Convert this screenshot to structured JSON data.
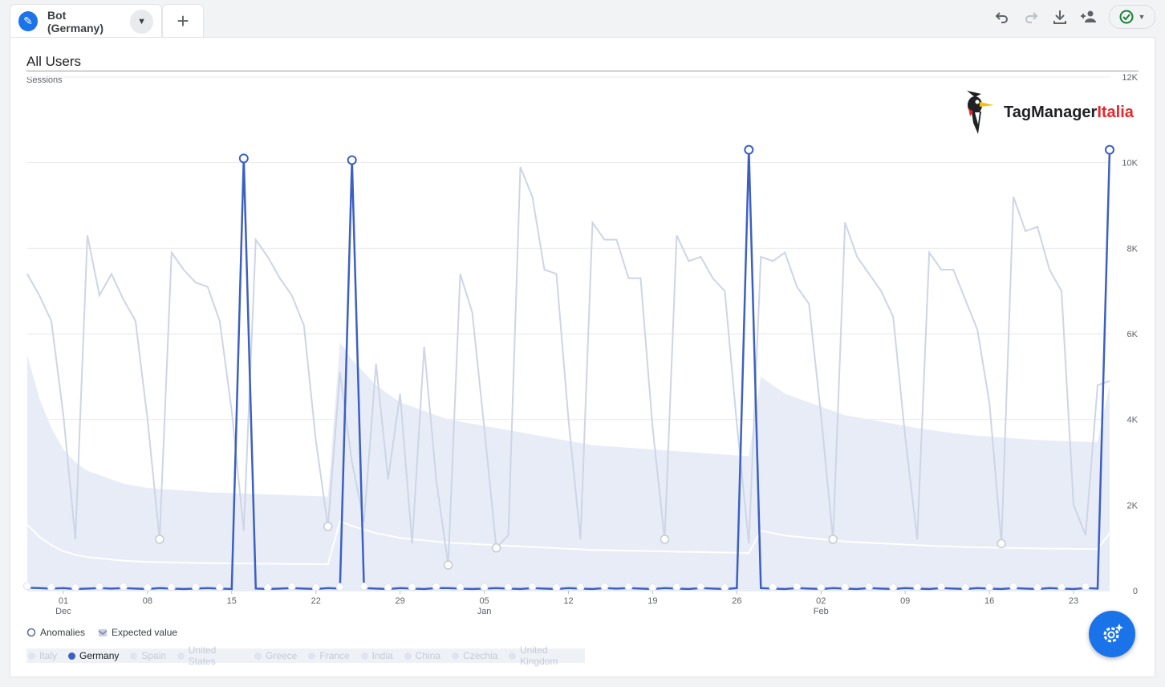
{
  "tab": {
    "segment_label": "Bot (Germany)",
    "add_label": "+"
  },
  "chart": {
    "title": "All Users",
    "metric": "Sessions"
  },
  "logo": {
    "part1": "TagManager",
    "part2": "Italia"
  },
  "legend_top": {
    "anomalies": "Anomalies",
    "expected": "Expected value"
  },
  "legend_countries": [
    "Italy",
    "Germany",
    "Spain",
    "United States",
    "Greece",
    "France",
    "India",
    "China",
    "Czechia",
    "United Kingdom"
  ],
  "active_country": "Germany",
  "colors": {
    "accent": "#1a73e8",
    "germany": "#3c5fc4",
    "faded": "#cdd5e6",
    "band": "#e8ecf7"
  },
  "chart_data": {
    "type": "line",
    "y_ticks": [
      "0",
      "2K",
      "4K",
      "6K",
      "8K",
      "10K",
      "12K"
    ],
    "ylim": [
      0,
      12000
    ],
    "x_ticks": [
      {
        "i": 3,
        "day": "01",
        "month": "Dec"
      },
      {
        "i": 10,
        "day": "08",
        "month": ""
      },
      {
        "i": 17,
        "day": "15",
        "month": ""
      },
      {
        "i": 24,
        "day": "22",
        "month": ""
      },
      {
        "i": 31,
        "day": "29",
        "month": ""
      },
      {
        "i": 38,
        "day": "05",
        "month": "Jan"
      },
      {
        "i": 45,
        "day": "12",
        "month": ""
      },
      {
        "i": 52,
        "day": "19",
        "month": ""
      },
      {
        "i": 59,
        "day": "26",
        "month": ""
      },
      {
        "i": 66,
        "day": "02",
        "month": "Feb"
      },
      {
        "i": 73,
        "day": "09",
        "month": ""
      },
      {
        "i": 80,
        "day": "16",
        "month": ""
      },
      {
        "i": 87,
        "day": "23",
        "month": ""
      }
    ],
    "x_count": 91,
    "series": [
      {
        "name": "Germany",
        "values": [
          70,
          60,
          50,
          60,
          40,
          50,
          60,
          50,
          60,
          50,
          40,
          60,
          50,
          40,
          50,
          60,
          50,
          40,
          10100,
          50,
          40,
          50,
          60,
          50,
          40,
          60,
          50,
          10060,
          60,
          50,
          40,
          60,
          50,
          40,
          60,
          60,
          50,
          40,
          50,
          60,
          50,
          40,
          60,
          50,
          40,
          60,
          50,
          40,
          60,
          50,
          60,
          50,
          40,
          60,
          50,
          40,
          60,
          50,
          40,
          60,
          10300,
          60,
          50,
          40,
          60,
          50,
          40,
          60,
          50,
          40,
          60,
          50,
          40,
          60,
          50,
          40,
          60,
          50,
          40,
          60,
          50,
          40,
          60,
          50,
          40,
          60,
          50,
          40,
          60,
          50,
          10300
        ]
      },
      {
        "name": "Other countries",
        "values": [
          7400,
          6900,
          6300,
          4100,
          1200,
          8300,
          6900,
          7400,
          6800,
          6300,
          4000,
          1200,
          7900,
          7500,
          7200,
          7100,
          6300,
          4200,
          1400,
          8200,
          7800,
          7300,
          6900,
          6200,
          3500,
          1500,
          5100,
          3000,
          1600,
          5300,
          2600,
          4600,
          1100,
          5700,
          2600,
          600,
          7400,
          6500,
          3800,
          1000,
          1300,
          9900,
          9200,
          7500,
          7400,
          4000,
          1200,
          8600,
          8200,
          8200,
          7300,
          7300,
          3800,
          1200,
          8300,
          7700,
          7800,
          7300,
          7000,
          3900,
          1100,
          7800,
          7700,
          7900,
          7100,
          6700,
          4100,
          1200,
          8600,
          7800,
          7400,
          7000,
          6400,
          3600,
          1200,
          7900,
          7500,
          7500,
          6800,
          6100,
          4400,
          1100,
          9200,
          8400,
          8500,
          7500,
          7000,
          2000,
          1300,
          4800,
          4900
        ]
      }
    ],
    "expected_upper": [
      5500,
      4500,
      3800,
      3300,
      3000,
      2800,
      2700,
      2600,
      2500,
      2450,
      2400,
      2380,
      2360,
      2340,
      2320,
      2300,
      2290,
      2280,
      2270,
      2260,
      2250,
      2240,
      2230,
      2220,
      2210,
      2200,
      5800,
      5400,
      5100,
      4800,
      4600,
      4400,
      4300,
      4200,
      4100,
      4000,
      3950,
      3900,
      3850,
      3800,
      3750,
      3700,
      3650,
      3600,
      3550,
      3500,
      3450,
      3400,
      3380,
      3360,
      3340,
      3320,
      3300,
      3280,
      3260,
      3240,
      3220,
      3200,
      3180,
      3160,
      3140,
      5000,
      4800,
      4600,
      4500,
      4400,
      4300,
      4200,
      4100,
      4050,
      4000,
      3950,
      3900,
      3850,
      3800,
      3760,
      3720,
      3680,
      3650,
      3620,
      3600,
      3580,
      3560,
      3540,
      3520,
      3510,
      3500,
      3490,
      3480,
      3470,
      4800
    ]
  }
}
